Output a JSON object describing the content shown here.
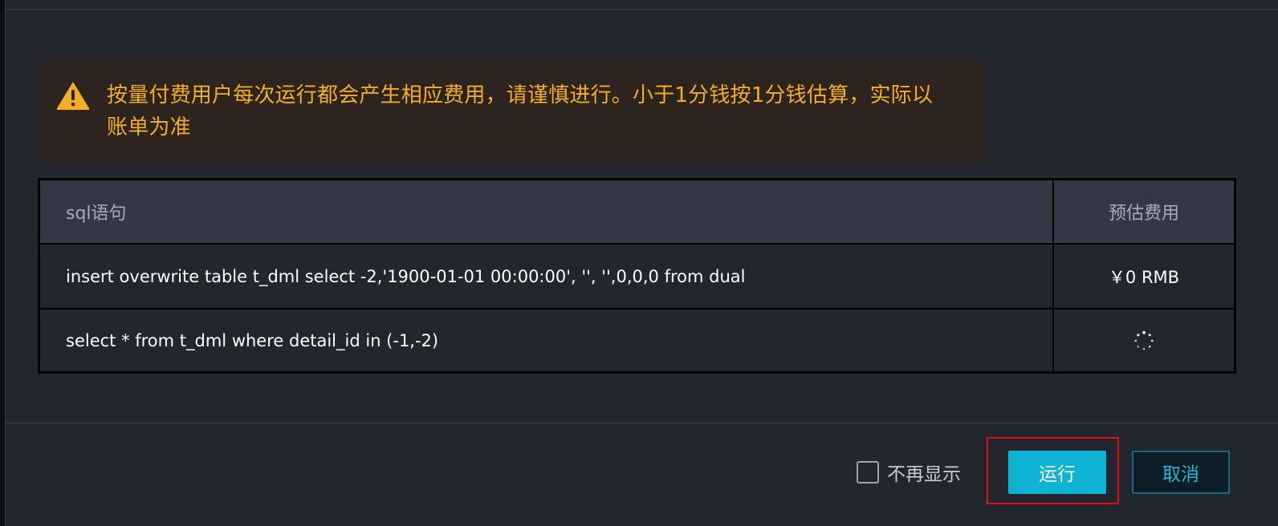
{
  "alert": {
    "icon": "warning-triangle-icon",
    "color": "#f5ad22",
    "text": "按量付费用户每次运行都会产生相应费用，请谨慎进行。小于1分钱按1分钱估算，实际以账单为准"
  },
  "table": {
    "columns": {
      "sql": "sql语句",
      "cost": "预估费用"
    },
    "rows": [
      {
        "sql": "insert overwrite table t_dml select -2,'1900-01-01 00:00:00', '', '',0,0,0 from dual",
        "cost": "￥0 RMB"
      },
      {
        "sql": "select * from t_dml where detail_id in (-1,-2)",
        "cost_icon": "loading-spinner-icon"
      }
    ]
  },
  "footer": {
    "no_show_label": "不再显示",
    "no_show_checked": false,
    "run_label": "运行",
    "cancel_label": "取消",
    "accent_color": "#0eb2d2",
    "highlight_color": "#e0101a"
  }
}
